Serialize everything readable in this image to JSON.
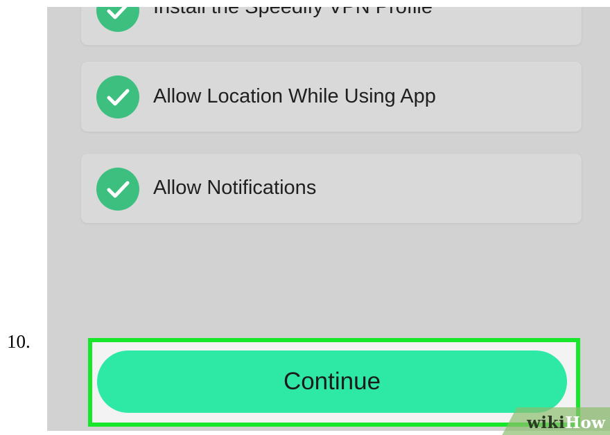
{
  "step": {
    "number": "10."
  },
  "checklist": {
    "items": [
      {
        "label": "Install the Speedify VPN Profile",
        "checked": true
      },
      {
        "label": "Allow Location While Using App",
        "checked": true
      },
      {
        "label": "Allow Notifications",
        "checked": true
      }
    ]
  },
  "continue_button": {
    "label": "Continue"
  },
  "watermark": {
    "part1": "wiki",
    "part2": "How"
  },
  "colors": {
    "check_green": "#3cbf7f",
    "button_green": "#2ee8a6",
    "highlight_green": "#18e62a"
  }
}
